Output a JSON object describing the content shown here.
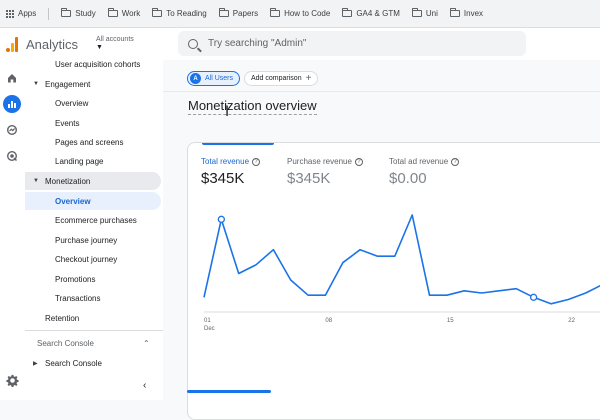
{
  "bookmarks": {
    "apps_label": "Apps",
    "folders": [
      "Study",
      "Work",
      "To Reading",
      "Papers",
      "How to Code",
      "GA4 & GTM",
      "Uni",
      "Invex"
    ]
  },
  "header": {
    "app_name": "Analytics",
    "account_label": "All accounts",
    "search_placeholder": "Try searching \"Admin\""
  },
  "rail": {
    "icons": [
      "home-icon",
      "reports-icon",
      "explore-icon",
      "advertising-icon"
    ],
    "active_index": 1,
    "accent": "#1a73e8"
  },
  "nav": {
    "items": [
      {
        "label": "User acquisition cohorts",
        "kind": "sub"
      },
      {
        "label": "Engagement",
        "kind": "section",
        "expanded": true
      },
      {
        "label": "Overview",
        "kind": "sub"
      },
      {
        "label": "Events",
        "kind": "sub"
      },
      {
        "label": "Pages and screens",
        "kind": "sub"
      },
      {
        "label": "Landing page",
        "kind": "sub"
      },
      {
        "label": "Monetization",
        "kind": "section",
        "expanded": true
      },
      {
        "label": "Overview",
        "kind": "sub",
        "selected": true
      },
      {
        "label": "Ecommerce purchases",
        "kind": "sub"
      },
      {
        "label": "Purchase journey",
        "kind": "sub"
      },
      {
        "label": "Checkout journey",
        "kind": "sub"
      },
      {
        "label": "Promotions",
        "kind": "sub"
      },
      {
        "label": "Transactions",
        "kind": "sub"
      },
      {
        "label": "Retention",
        "kind": "section"
      }
    ],
    "search_console_header": "Search Console",
    "search_console_item": "Search Console"
  },
  "main": {
    "segment_label": "All Users",
    "segment_badge": "A",
    "add_comparison_label": "Add comparison",
    "page_title": "Monetization overview"
  },
  "metrics": [
    {
      "label": "Total revenue",
      "value": "$345K",
      "active": true
    },
    {
      "label": "Purchase revenue",
      "value": "$345K",
      "active": false
    },
    {
      "label": "Total ad revenue",
      "value": "$0.00",
      "active": false
    }
  ],
  "chart_data": {
    "type": "line",
    "x_tick_labels": [
      {
        "day": 1,
        "label": "01",
        "sublabel": "Dec"
      },
      {
        "day": 8,
        "label": "08"
      },
      {
        "day": 15,
        "label": "15"
      },
      {
        "day": 22,
        "label": "22"
      }
    ],
    "x": [
      1,
      2,
      3,
      4,
      5,
      6,
      7,
      8,
      9,
      10,
      11,
      12,
      13,
      14,
      15,
      16,
      17,
      18,
      19,
      20,
      21,
      22,
      23,
      24
    ],
    "values": [
      4,
      40,
      15,
      19,
      26,
      12,
      5,
      5,
      20,
      26,
      23,
      23,
      42,
      5,
      5,
      7,
      6,
      7,
      8,
      4,
      1,
      3,
      6,
      10
    ],
    "highlight_days": [
      2,
      20
    ],
    "series_color": "#1a73e8",
    "xlim": [
      1,
      24
    ],
    "grid": false
  }
}
